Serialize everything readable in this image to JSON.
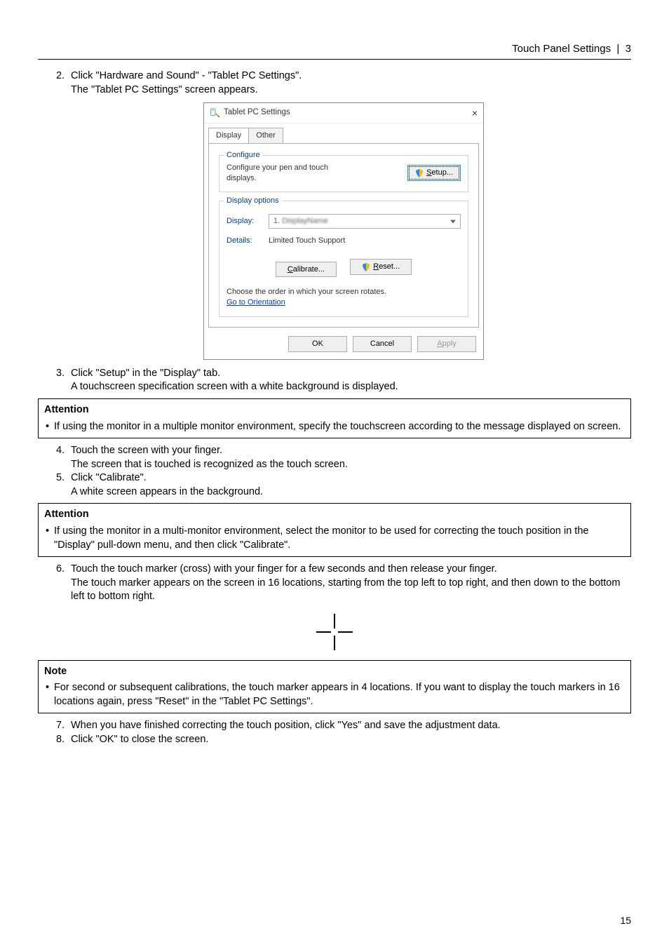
{
  "header": {
    "section": "Touch Panel Settings",
    "chapter": "3"
  },
  "steps": {
    "s2a": "Click \"Hardware and Sound\" - \"Tablet PC Settings\".",
    "s2b": "The \"Tablet PC Settings\" screen appears.",
    "s3a": "Click \"Setup\" in the \"Display\" tab.",
    "s3b": "A touchscreen specification screen with a white background is displayed.",
    "s4a": "Touch the screen with your finger.",
    "s4b": "The screen that is touched is recognized as the touch screen.",
    "s5a": "Click \"Calibrate\".",
    "s5b": "A white screen appears in the background.",
    "s6a": "Touch the touch marker (cross) with your finger for a few seconds and then release your finger.",
    "s6b": "The touch marker appears on the screen in 16 locations, starting from the top left to top right, and then down to the bottom left to bottom right.",
    "s7": "When you have finished correcting the touch position, click \"Yes\" and save the adjustment data.",
    "s8": "Click \"OK\" to close the screen."
  },
  "attention": {
    "title": "Attention",
    "a1": "If using the monitor in a multiple monitor environment, specify the touchscreen according to the message displayed on screen.",
    "a2": "If using the monitor in a multi-monitor environment, select the monitor to be used for correcting the touch position in the \"Display\" pull-down menu, and then click \"Calibrate\"."
  },
  "note": {
    "title": "Note",
    "n1": "For second or subsequent calibrations, the touch marker appears in 4 locations. If you want to display the touch markers in 16 locations again, press \"Reset\" in the \"Tablet PC Settings\"."
  },
  "dialog": {
    "title": "Tablet PC Settings",
    "tabs": {
      "display": "Display",
      "other": "Other"
    },
    "configure": {
      "legend": "Configure",
      "text": "Configure your pen and touch displays.",
      "setup_prefix": "S",
      "setup": "etup..."
    },
    "display_options": {
      "legend": "Display options",
      "display_label": "Display:",
      "display_value_prefix": "1. ",
      "display_value_blur": "DisplayName",
      "details_label": "Details:",
      "details_value": "Limited Touch Support",
      "calibrate_prefix": "C",
      "calibrate": "alibrate...",
      "reset_prefix": "R",
      "reset": "eset...",
      "order_text": "Choose the order in which your screen rotates.",
      "order_link": "Go to Orientation"
    },
    "footer": {
      "ok": "OK",
      "cancel": "Cancel",
      "apply_prefix": "A",
      "apply": "pply"
    }
  },
  "pagenum": "15"
}
